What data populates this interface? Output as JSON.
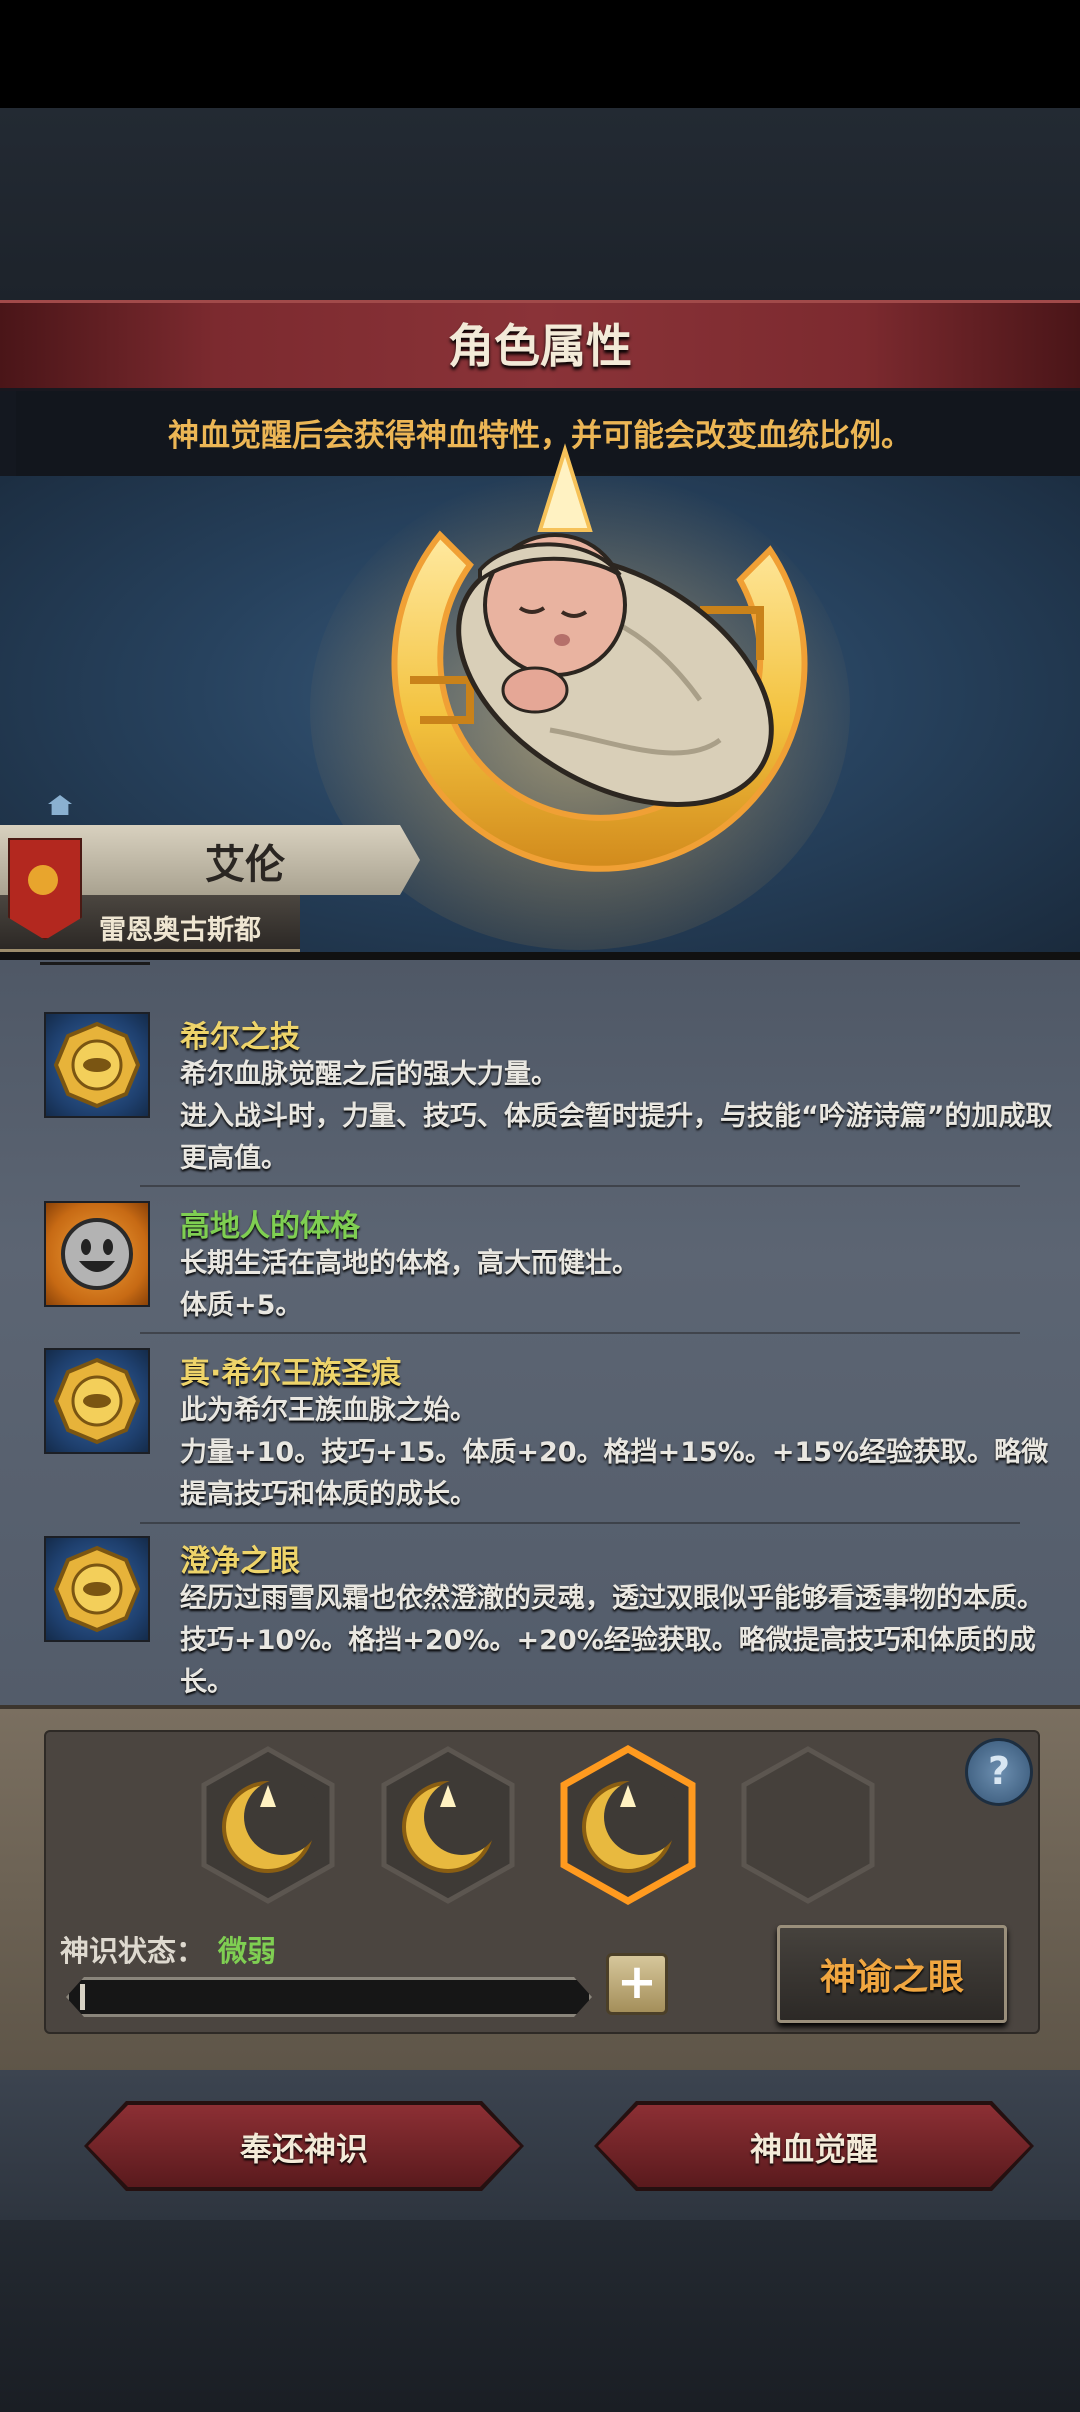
{
  "header": {
    "title": "角色属性"
  },
  "hint": "神血觉醒后会获得神血特性，并可能会改变血统比例。",
  "character": {
    "name": "艾伦",
    "origin": "雷恩奥古斯都"
  },
  "traits": [
    {
      "name": "希尔之技",
      "name_color": "gold",
      "icon": "golden-emblem-icon",
      "desc": "希尔血脉觉醒之后的强大力量。\n进入战斗时，力量、技巧、体质会暂时提升，与技能“吟游诗篇”的加成取更高值。"
    },
    {
      "name": "高地人的体格",
      "name_color": "green",
      "icon": "smiley-face-icon",
      "desc": "长期生活在高地的体格，高大而健壮。\n体质+5。"
    },
    {
      "name": "真·希尔王族圣痕",
      "name_color": "gold",
      "icon": "golden-emblem-icon",
      "desc": "此为希尔王族血脉之始。\n力量+10。技巧+15。体质+20。格挡+15%。+15%经验获取。略微提高技巧和体质的成长。"
    },
    {
      "name": "澄净之眼",
      "name_color": "gold",
      "icon": "golden-emblem-icon",
      "desc": "经历过雨雪风霜也依然澄澈的灵魂，透过双眼似乎能够看透事物的本质。\n技巧+10%。格挡+20%。+20%经验获取。略微提高技巧和体质的成长。"
    }
  ],
  "slots": [
    {
      "icon": "crescent-emblem-icon",
      "filled": true,
      "selected": false
    },
    {
      "icon": "crescent-emblem-icon",
      "filled": true,
      "selected": false
    },
    {
      "icon": "crescent-emblem-icon",
      "filled": true,
      "selected": true
    },
    {
      "icon": "empty-slot-icon",
      "filled": false,
      "selected": false
    }
  ],
  "status": {
    "label": "神识状态：",
    "value": "微弱",
    "progress": 0.01
  },
  "buttons": {
    "oracle": "神谕之眼",
    "return": "奉还神识",
    "awaken": "神血觉醒",
    "help": "?",
    "plus": "+"
  },
  "colors": {
    "gold_text": "#eed46a",
    "green_text": "#7fcf52",
    "hint_text": "#ecb655",
    "accent_orange": "#f0a640",
    "banner_red": "#8a3338"
  }
}
